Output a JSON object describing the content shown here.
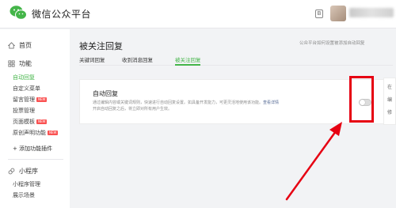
{
  "header": {
    "brand": "微信公众平台",
    "icon_glyph": "B"
  },
  "sidebar": {
    "home": "首页",
    "features": "功能",
    "feature_items": [
      {
        "label": "自动回复",
        "active": true
      },
      {
        "label": "自定义菜单"
      },
      {
        "label": "留言管理",
        "badge": "NEW"
      },
      {
        "label": "投票管理"
      },
      {
        "label": "页面模板",
        "badge": "NEW"
      },
      {
        "label": "原创声明功能",
        "badge": "NEW"
      }
    ],
    "add_plugin": "+ 添加功能插件",
    "miniprogram": "小程序",
    "mini_items": [
      "小程序管理",
      "展示场景"
    ]
  },
  "main": {
    "title": "被关注回复",
    "help_link": "公众平台如何设置被添加自动回复",
    "tabs": [
      "关键词回复",
      "收到消息回复",
      "被关注回复"
    ],
    "active_tab": 2,
    "card": {
      "title": "自动回复",
      "desc_line1": "通过编辑内容或关键词规则，快速进行自动回复设置。如具备开发能力，可更灵活地使用该功能。",
      "desc_link": "查看详情",
      "desc_line2": "开启自动回复之后，将立即对所有用户生效。",
      "toggle_on": false
    },
    "side_panel_chars": [
      "在",
      "编",
      "修"
    ]
  },
  "colors": {
    "accent": "#44b549",
    "annotation": "#e60012",
    "link": "#576b95"
  }
}
